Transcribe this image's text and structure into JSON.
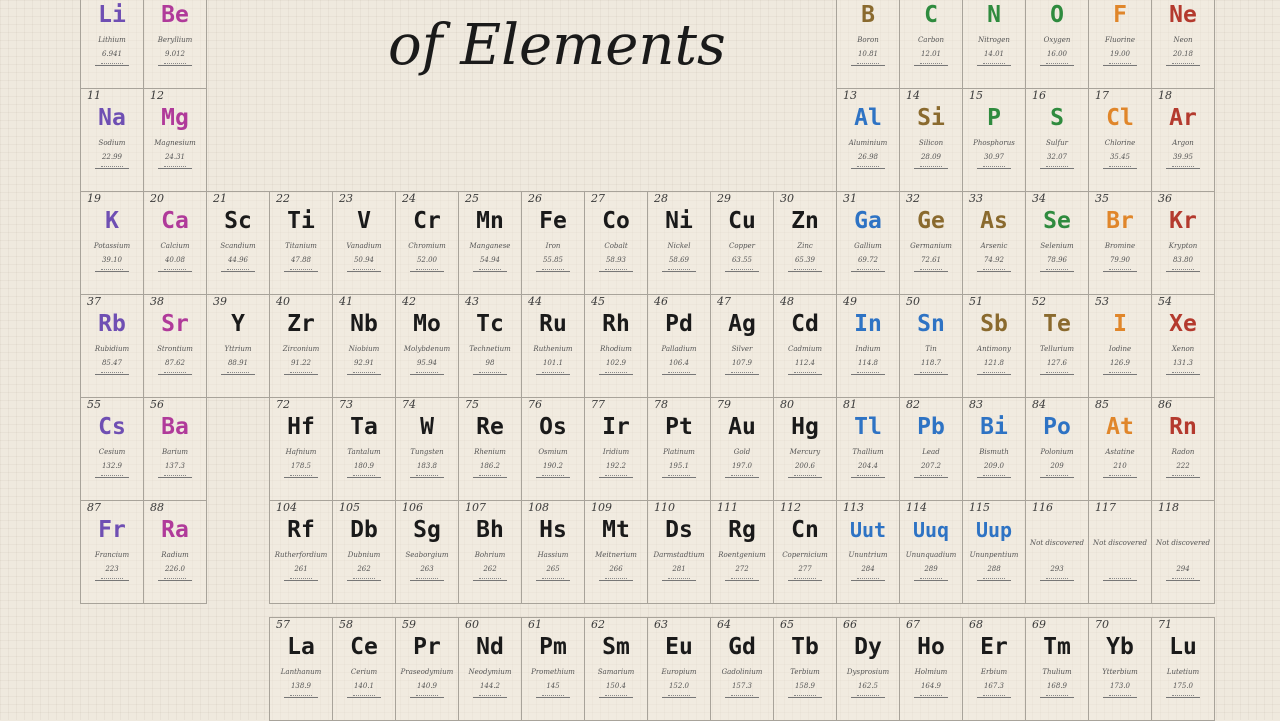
{
  "title": "of Elements",
  "colors": {
    "black": "#1a1a1a",
    "violet": "#6f4fb3",
    "magenta": "#b03a9a",
    "blue": "#2e73c4",
    "green": "#2f8b3e",
    "orange": "#e0862a",
    "red": "#b43a2e",
    "brown": "#8a6a2e",
    "gray": "#444444"
  },
  "elements": [
    {
      "n": "",
      "s": "Li",
      "name": "Lithium",
      "m": "6.941",
      "c": "violet",
      "col": 1,
      "row": 0
    },
    {
      "n": "",
      "s": "Be",
      "name": "Beryllium",
      "m": "9.012",
      "c": "magenta",
      "col": 2,
      "row": 0
    },
    {
      "n": "",
      "s": "B",
      "name": "Boron",
      "m": "10.81",
      "c": "brown",
      "col": 13,
      "row": 0
    },
    {
      "n": "",
      "s": "C",
      "name": "Carbon",
      "m": "12.01",
      "c": "green",
      "col": 14,
      "row": 0
    },
    {
      "n": "",
      "s": "N",
      "name": "Nitrogen",
      "m": "14.01",
      "c": "green",
      "col": 15,
      "row": 0
    },
    {
      "n": "",
      "s": "O",
      "name": "Oxygen",
      "m": "16.00",
      "c": "green",
      "col": 16,
      "row": 0
    },
    {
      "n": "",
      "s": "F",
      "name": "Fluorine",
      "m": "19.00",
      "c": "orange",
      "col": 17,
      "row": 0
    },
    {
      "n": "",
      "s": "Ne",
      "name": "Neon",
      "m": "20.18",
      "c": "red",
      "col": 18,
      "row": 0
    },
    {
      "n": "11",
      "s": "Na",
      "name": "Sodium",
      "m": "22.99",
      "c": "violet",
      "col": 1,
      "row": 1
    },
    {
      "n": "12",
      "s": "Mg",
      "name": "Magnesium",
      "m": "24.31",
      "c": "magenta",
      "col": 2,
      "row": 1
    },
    {
      "n": "13",
      "s": "Al",
      "name": "Aluminium",
      "m": "26.98",
      "c": "blue",
      "col": 13,
      "row": 1
    },
    {
      "n": "14",
      "s": "Si",
      "name": "Silicon",
      "m": "28.09",
      "c": "brown",
      "col": 14,
      "row": 1
    },
    {
      "n": "15",
      "s": "P",
      "name": "Phosphorus",
      "m": "30.97",
      "c": "green",
      "col": 15,
      "row": 1
    },
    {
      "n": "16",
      "s": "S",
      "name": "Sulfur",
      "m": "32.07",
      "c": "green",
      "col": 16,
      "row": 1
    },
    {
      "n": "17",
      "s": "Cl",
      "name": "Chlorine",
      "m": "35.45",
      "c": "orange",
      "col": 17,
      "row": 1
    },
    {
      "n": "18",
      "s": "Ar",
      "name": "Argon",
      "m": "39.95",
      "c": "red",
      "col": 18,
      "row": 1
    },
    {
      "n": "19",
      "s": "K",
      "name": "Potassium",
      "m": "39.10",
      "c": "violet",
      "col": 1,
      "row": 2
    },
    {
      "n": "20",
      "s": "Ca",
      "name": "Calcium",
      "m": "40.08",
      "c": "magenta",
      "col": 2,
      "row": 2
    },
    {
      "n": "21",
      "s": "Sc",
      "name": "Scandium",
      "m": "44.96",
      "c": "black",
      "col": 3,
      "row": 2
    },
    {
      "n": "22",
      "s": "Ti",
      "name": "Titanium",
      "m": "47.88",
      "c": "black",
      "col": 4,
      "row": 2
    },
    {
      "n": "23",
      "s": "V",
      "name": "Vanadium",
      "m": "50.94",
      "c": "black",
      "col": 5,
      "row": 2
    },
    {
      "n": "24",
      "s": "Cr",
      "name": "Chromium",
      "m": "52.00",
      "c": "black",
      "col": 6,
      "row": 2
    },
    {
      "n": "25",
      "s": "Mn",
      "name": "Manganese",
      "m": "54.94",
      "c": "black",
      "col": 7,
      "row": 2
    },
    {
      "n": "26",
      "s": "Fe",
      "name": "Iron",
      "m": "55.85",
      "c": "black",
      "col": 8,
      "row": 2
    },
    {
      "n": "27",
      "s": "Co",
      "name": "Cobalt",
      "m": "58.93",
      "c": "black",
      "col": 9,
      "row": 2
    },
    {
      "n": "28",
      "s": "Ni",
      "name": "Nickel",
      "m": "58.69",
      "c": "black",
      "col": 10,
      "row": 2
    },
    {
      "n": "29",
      "s": "Cu",
      "name": "Copper",
      "m": "63.55",
      "c": "black",
      "col": 11,
      "row": 2
    },
    {
      "n": "30",
      "s": "Zn",
      "name": "Zinc",
      "m": "65.39",
      "c": "black",
      "col": 12,
      "row": 2
    },
    {
      "n": "31",
      "s": "Ga",
      "name": "Gallium",
      "m": "69.72",
      "c": "blue",
      "col": 13,
      "row": 2
    },
    {
      "n": "32",
      "s": "Ge",
      "name": "Germanium",
      "m": "72.61",
      "c": "brown",
      "col": 14,
      "row": 2
    },
    {
      "n": "33",
      "s": "As",
      "name": "Arsenic",
      "m": "74.92",
      "c": "brown",
      "col": 15,
      "row": 2
    },
    {
      "n": "34",
      "s": "Se",
      "name": "Selenium",
      "m": "78.96",
      "c": "green",
      "col": 16,
      "row": 2
    },
    {
      "n": "35",
      "s": "Br",
      "name": "Bromine",
      "m": "79.90",
      "c": "orange",
      "col": 17,
      "row": 2
    },
    {
      "n": "36",
      "s": "Kr",
      "name": "Krypton",
      "m": "83.80",
      "c": "red",
      "col": 18,
      "row": 2
    },
    {
      "n": "37",
      "s": "Rb",
      "name": "Rubidium",
      "m": "85.47",
      "c": "violet",
      "col": 1,
      "row": 3
    },
    {
      "n": "38",
      "s": "Sr",
      "name": "Strontium",
      "m": "87.62",
      "c": "magenta",
      "col": 2,
      "row": 3
    },
    {
      "n": "39",
      "s": "Y",
      "name": "Yttrium",
      "m": "88.91",
      "c": "black",
      "col": 3,
      "row": 3
    },
    {
      "n": "40",
      "s": "Zr",
      "name": "Zirconium",
      "m": "91.22",
      "c": "black",
      "col": 4,
      "row": 3
    },
    {
      "n": "41",
      "s": "Nb",
      "name": "Niobium",
      "m": "92.91",
      "c": "black",
      "col": 5,
      "row": 3
    },
    {
      "n": "42",
      "s": "Mo",
      "name": "Molybdenum",
      "m": "95.94",
      "c": "black",
      "col": 6,
      "row": 3
    },
    {
      "n": "43",
      "s": "Tc",
      "name": "Technetium",
      "m": "98",
      "c": "black",
      "col": 7,
      "row": 3
    },
    {
      "n": "44",
      "s": "Ru",
      "name": "Ruthenium",
      "m": "101.1",
      "c": "black",
      "col": 8,
      "row": 3
    },
    {
      "n": "45",
      "s": "Rh",
      "name": "Rhodium",
      "m": "102.9",
      "c": "black",
      "col": 9,
      "row": 3
    },
    {
      "n": "46",
      "s": "Pd",
      "name": "Palladium",
      "m": "106.4",
      "c": "black",
      "col": 10,
      "row": 3
    },
    {
      "n": "47",
      "s": "Ag",
      "name": "Silver",
      "m": "107.9",
      "c": "black",
      "col": 11,
      "row": 3
    },
    {
      "n": "48",
      "s": "Cd",
      "name": "Cadmium",
      "m": "112.4",
      "c": "black",
      "col": 12,
      "row": 3
    },
    {
      "n": "49",
      "s": "In",
      "name": "Indium",
      "m": "114.8",
      "c": "blue",
      "col": 13,
      "row": 3
    },
    {
      "n": "50",
      "s": "Sn",
      "name": "Tin",
      "m": "118.7",
      "c": "blue",
      "col": 14,
      "row": 3
    },
    {
      "n": "51",
      "s": "Sb",
      "name": "Antimony",
      "m": "121.8",
      "c": "brown",
      "col": 15,
      "row": 3
    },
    {
      "n": "52",
      "s": "Te",
      "name": "Tellurium",
      "m": "127.6",
      "c": "brown",
      "col": 16,
      "row": 3
    },
    {
      "n": "53",
      "s": "I",
      "name": "Iodine",
      "m": "126.9",
      "c": "orange",
      "col": 17,
      "row": 3
    },
    {
      "n": "54",
      "s": "Xe",
      "name": "Xenon",
      "m": "131.3",
      "c": "red",
      "col": 18,
      "row": 3
    },
    {
      "n": "55",
      "s": "Cs",
      "name": "Cesium",
      "m": "132.9",
      "c": "violet",
      "col": 1,
      "row": 4
    },
    {
      "n": "56",
      "s": "Ba",
      "name": "Barium",
      "m": "137.3",
      "c": "magenta",
      "col": 2,
      "row": 4
    },
    {
      "n": "72",
      "s": "Hf",
      "name": "Hafnium",
      "m": "178.5",
      "c": "black",
      "col": 4,
      "row": 4
    },
    {
      "n": "73",
      "s": "Ta",
      "name": "Tantalum",
      "m": "180.9",
      "c": "black",
      "col": 5,
      "row": 4
    },
    {
      "n": "74",
      "s": "W",
      "name": "Tungsten",
      "m": "183.8",
      "c": "black",
      "col": 6,
      "row": 4
    },
    {
      "n": "75",
      "s": "Re",
      "name": "Rhenium",
      "m": "186.2",
      "c": "black",
      "col": 7,
      "row": 4
    },
    {
      "n": "76",
      "s": "Os",
      "name": "Osmium",
      "m": "190.2",
      "c": "black",
      "col": 8,
      "row": 4
    },
    {
      "n": "77",
      "s": "Ir",
      "name": "Iridium",
      "m": "192.2",
      "c": "black",
      "col": 9,
      "row": 4
    },
    {
      "n": "78",
      "s": "Pt",
      "name": "Platinum",
      "m": "195.1",
      "c": "black",
      "col": 10,
      "row": 4
    },
    {
      "n": "79",
      "s": "Au",
      "name": "Gold",
      "m": "197.0",
      "c": "black",
      "col": 11,
      "row": 4
    },
    {
      "n": "80",
      "s": "Hg",
      "name": "Mercury",
      "m": "200.6",
      "c": "black",
      "col": 12,
      "row": 4
    },
    {
      "n": "81",
      "s": "Tl",
      "name": "Thallium",
      "m": "204.4",
      "c": "blue",
      "col": 13,
      "row": 4
    },
    {
      "n": "82",
      "s": "Pb",
      "name": "Lead",
      "m": "207.2",
      "c": "blue",
      "col": 14,
      "row": 4
    },
    {
      "n": "83",
      "s": "Bi",
      "name": "Bismuth",
      "m": "209.0",
      "c": "blue",
      "col": 15,
      "row": 4
    },
    {
      "n": "84",
      "s": "Po",
      "name": "Polonium",
      "m": "209",
      "c": "blue",
      "col": 16,
      "row": 4
    },
    {
      "n": "85",
      "s": "At",
      "name": "Astatine",
      "m": "210",
      "c": "orange",
      "col": 17,
      "row": 4
    },
    {
      "n": "86",
      "s": "Rn",
      "name": "Radon",
      "m": "222",
      "c": "red",
      "col": 18,
      "row": 4
    },
    {
      "n": "87",
      "s": "Fr",
      "name": "Francium",
      "m": "223",
      "c": "violet",
      "col": 1,
      "row": 5
    },
    {
      "n": "88",
      "s": "Ra",
      "name": "Radium",
      "m": "226.0",
      "c": "magenta",
      "col": 2,
      "row": 5
    },
    {
      "n": "104",
      "s": "Rf",
      "name": "Rutherfordium",
      "m": "261",
      "c": "black",
      "col": 4,
      "row": 5
    },
    {
      "n": "105",
      "s": "Db",
      "name": "Dubnium",
      "m": "262",
      "c": "black",
      "col": 5,
      "row": 5
    },
    {
      "n": "106",
      "s": "Sg",
      "name": "Seaborgium",
      "m": "263",
      "c": "black",
      "col": 6,
      "row": 5
    },
    {
      "n": "107",
      "s": "Bh",
      "name": "Bohrium",
      "m": "262",
      "c": "black",
      "col": 7,
      "row": 5
    },
    {
      "n": "108",
      "s": "Hs",
      "name": "Hassium",
      "m": "265",
      "c": "black",
      "col": 8,
      "row": 5
    },
    {
      "n": "109",
      "s": "Mt",
      "name": "Meitnerium",
      "m": "266",
      "c": "black",
      "col": 9,
      "row": 5
    },
    {
      "n": "110",
      "s": "Ds",
      "name": "Darmstadtium",
      "m": "281",
      "c": "black",
      "col": 10,
      "row": 5
    },
    {
      "n": "111",
      "s": "Rg",
      "name": "Roentgenium",
      "m": "272",
      "c": "black",
      "col": 11,
      "row": 5
    },
    {
      "n": "112",
      "s": "Cn",
      "name": "Copernicium",
      "m": "277",
      "c": "black",
      "col": 12,
      "row": 5
    },
    {
      "n": "113",
      "s": "Uut",
      "name": "Ununtrium",
      "m": "284",
      "c": "blue",
      "col": 13,
      "row": 5
    },
    {
      "n": "114",
      "s": "Uuq",
      "name": "Ununquadium",
      "m": "289",
      "c": "blue",
      "col": 14,
      "row": 5
    },
    {
      "n": "115",
      "s": "Uup",
      "name": "Ununpentium",
      "m": "288",
      "c": "blue",
      "col": 15,
      "row": 5
    },
    {
      "n": "116",
      "s": "",
      "name": "Not discovered",
      "m": "293",
      "c": "gray",
      "col": 16,
      "row": 5
    },
    {
      "n": "117",
      "s": "",
      "name": "Not discovered",
      "m": "",
      "c": "gray",
      "col": 17,
      "row": 5
    },
    {
      "n": "118",
      "s": "",
      "name": "Not discovered",
      "m": "294",
      "c": "gray",
      "col": 18,
      "row": 5
    },
    {
      "n": "57",
      "s": "La",
      "name": "Lanthanum",
      "m": "138.9",
      "c": "black",
      "col": 4,
      "row": 6
    },
    {
      "n": "58",
      "s": "Ce",
      "name": "Cerium",
      "m": "140.1",
      "c": "black",
      "col": 5,
      "row": 6
    },
    {
      "n": "59",
      "s": "Pr",
      "name": "Praseodymium",
      "m": "140.9",
      "c": "black",
      "col": 6,
      "row": 6
    },
    {
      "n": "60",
      "s": "Nd",
      "name": "Neodymium",
      "m": "144.2",
      "c": "black",
      "col": 7,
      "row": 6
    },
    {
      "n": "61",
      "s": "Pm",
      "name": "Promethium",
      "m": "145",
      "c": "black",
      "col": 8,
      "row": 6
    },
    {
      "n": "62",
      "s": "Sm",
      "name": "Samarium",
      "m": "150.4",
      "c": "black",
      "col": 9,
      "row": 6
    },
    {
      "n": "63",
      "s": "Eu",
      "name": "Europium",
      "m": "152.0",
      "c": "black",
      "col": 10,
      "row": 6
    },
    {
      "n": "64",
      "s": "Gd",
      "name": "Gadolinium",
      "m": "157.3",
      "c": "black",
      "col": 11,
      "row": 6
    },
    {
      "n": "65",
      "s": "Tb",
      "name": "Terbium",
      "m": "158.9",
      "c": "black",
      "col": 12,
      "row": 6
    },
    {
      "n": "66",
      "s": "Dy",
      "name": "Dysprosium",
      "m": "162.5",
      "c": "black",
      "col": 13,
      "row": 6
    },
    {
      "n": "67",
      "s": "Ho",
      "name": "Holmium",
      "m": "164.9",
      "c": "black",
      "col": 14,
      "row": 6
    },
    {
      "n": "68",
      "s": "Er",
      "name": "Erbium",
      "m": "167.3",
      "c": "black",
      "col": 15,
      "row": 6
    },
    {
      "n": "69",
      "s": "Tm",
      "name": "Thulium",
      "m": "168.9",
      "c": "black",
      "col": 16,
      "row": 6
    },
    {
      "n": "70",
      "s": "Yb",
      "name": "Ytterbium",
      "m": "173.0",
      "c": "black",
      "col": 17,
      "row": 6
    },
    {
      "n": "71",
      "s": "Lu",
      "name": "Lutetium",
      "m": "175.0",
      "c": "black",
      "col": 18,
      "row": 6
    }
  ]
}
